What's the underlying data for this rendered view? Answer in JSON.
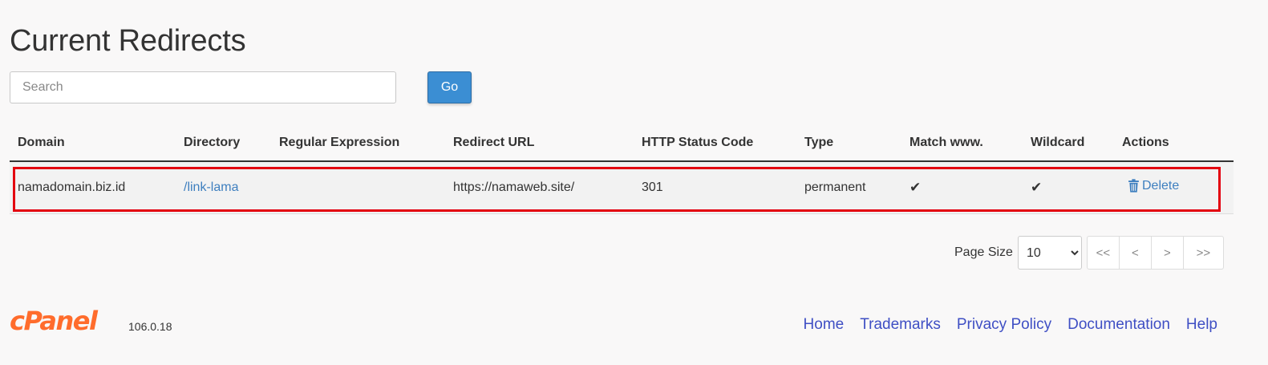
{
  "page": {
    "title": "Current Redirects"
  },
  "search": {
    "placeholder": "Search",
    "value": "",
    "go_label": "Go"
  },
  "table": {
    "headers": {
      "domain": "Domain",
      "directory": "Directory",
      "regex": "Regular Expression",
      "redirect_url": "Redirect URL",
      "status": "HTTP Status Code",
      "type": "Type",
      "match_www": "Match www.",
      "wildcard": "Wildcard",
      "actions": "Actions"
    },
    "rows": [
      {
        "domain": "namadomain.biz.id",
        "directory": "/link-lama",
        "regex": "",
        "redirect_url": "https://namaweb.site/",
        "status": "301",
        "type": "permanent",
        "match_www": "✔",
        "wildcard": "✔",
        "action_label": "Delete"
      }
    ]
  },
  "pagination": {
    "page_size_label": "Page Size",
    "page_size": "10",
    "first": "<<",
    "prev": "<",
    "next": ">",
    "last": ">>"
  },
  "footer": {
    "logo": "cPanel",
    "version": "106.0.18",
    "links": [
      "Home",
      "Trademarks",
      "Privacy Policy",
      "Documentation",
      "Help"
    ]
  },
  "colors": {
    "logo_orange": "#ff6c2c",
    "go_button": "#3b8ed3",
    "link_blue": "#3e7fbf",
    "footer_link": "#3f4fc4",
    "highlight_red": "#e3000f"
  },
  "icons": {
    "check": "checkmark-icon",
    "delete": "trash-icon",
    "dropdown": "chevron-down-icon"
  }
}
